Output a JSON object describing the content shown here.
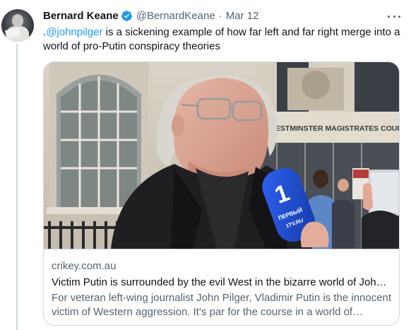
{
  "tweet": {
    "author_name": "Bernard Keane",
    "author_handle": "@BernardKeane",
    "separator": "·",
    "date": "Mar 12",
    "text_prefix": ".",
    "mention": "@johnpilger",
    "text_body": " is a sickening example of how far left and far right merge into a world of pro-Putin conspiracy theories"
  },
  "card": {
    "domain": "crikey.com.au",
    "title": "Victim Putin is surrounded by the evil West in the bizarre world of John Pilger",
    "description": "For veteran left-wing journalist John Pilger, Vladimir Putin is the innocent victim of Western aggression. It's par for the course in a world of conspiracy theories.",
    "image": {
      "building_sign": "WESTMINSTER MAGISTRATES COURT",
      "mic_brand": "ПЕРВЫЙ",
      "mic_url": "1TV.RU"
    }
  },
  "icons": {
    "verified": "verified-badge-icon",
    "more": "more-options-icon"
  },
  "colors": {
    "link": "#1d9bf0",
    "secondary_text": "#536471",
    "border": "#cfd9de",
    "mic_blue": "#1f4fd6"
  }
}
